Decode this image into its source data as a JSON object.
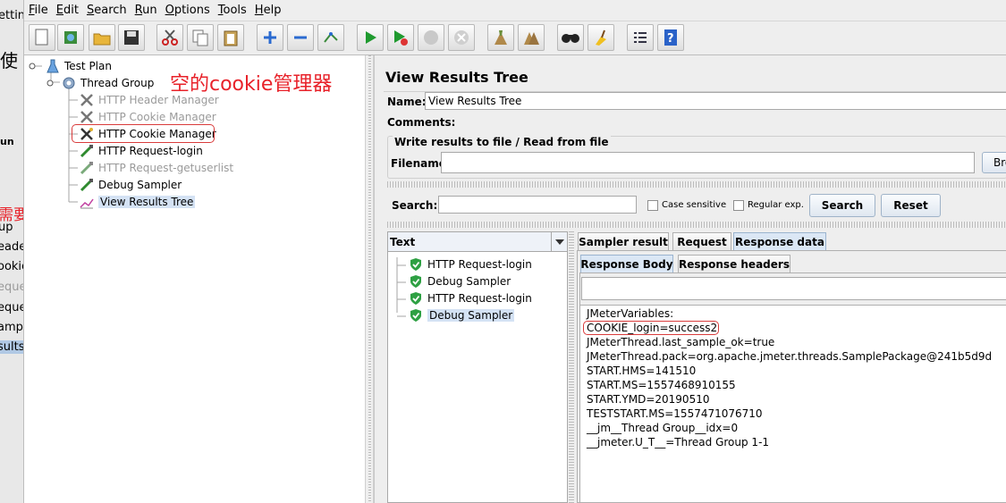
{
  "menubar": {
    "items": [
      "File",
      "Edit",
      "Search",
      "Run",
      "Options",
      "Tools",
      "Help"
    ]
  },
  "toolbar": {
    "icons": [
      "new-icon",
      "templates-icon",
      "open-icon",
      "save-icon",
      "cut-icon",
      "copy-icon",
      "paste-icon",
      "expand-icon",
      "collapse-icon",
      "toggle-icon",
      "start-icon",
      "start-no-pause-icon",
      "stop-icon",
      "shutdown-icon",
      "clear-icon",
      "clear-all-icon",
      "search-icon",
      "reset-search-icon",
      "function-helper-icon",
      "help-icon"
    ]
  },
  "left_strip": {
    "items": [
      "etting",
      "使",
      "un",
      "需要",
      "up",
      "eade",
      "ookie",
      "eque",
      "eque",
      "amp",
      "sults"
    ]
  },
  "tree": {
    "test_plan": "Test Plan",
    "thread_group": "Thread Group",
    "header_manager": "HTTP Header Manager",
    "cookie_manager_disabled": "HTTP Cookie Manager",
    "cookie_manager": "HTTP Cookie Manager",
    "request_login": "HTTP Request-login",
    "request_getuserlist": "HTTP Request-getuserlist",
    "debug_sampler": "Debug Sampler",
    "view_results_tree": "View Results Tree"
  },
  "annotation": "空的cookie管理器",
  "panel": {
    "title": "View Results Tree",
    "name_label": "Name:",
    "name_value": "View Results Tree",
    "comments_label": "Comments:",
    "write_results_label": "Write results to file / Read from file",
    "filename_label": "Filename",
    "browse_label": "Bro",
    "search_label": "Search:",
    "search_value": "",
    "case_sensitive": "Case sensitive",
    "regular_exp": "Regular exp.",
    "search_button": "Search",
    "reset_button": "Reset",
    "renderer": "Text"
  },
  "results": {
    "items": [
      "HTTP Request-login",
      "Debug Sampler",
      "HTTP Request-login",
      "Debug Sampler"
    ]
  },
  "tabs": {
    "sampler_result": "Sampler result",
    "request": "Request",
    "response_data": "Response data",
    "response_body": "Response Body",
    "response_headers": "Response headers"
  },
  "response": {
    "lines": [
      "JMeterVariables:",
      "COOKIE_login=success2",
      "JMeterThread.last_sample_ok=true",
      "JMeterThread.pack=org.apache.jmeter.threads.SamplePackage@241b5d9d",
      "START.HMS=141510",
      "START.MS=1557468910155",
      "START.YMD=20190510",
      "TESTSTART.MS=1557471076710",
      "__jm__Thread Group__idx=0",
      "__jmeter.U_T__=Thread Group 1-1"
    ]
  },
  "colors": {
    "accent": "#d93c3c",
    "selection": "#d4e2f4",
    "check_green": "#2ea043"
  }
}
